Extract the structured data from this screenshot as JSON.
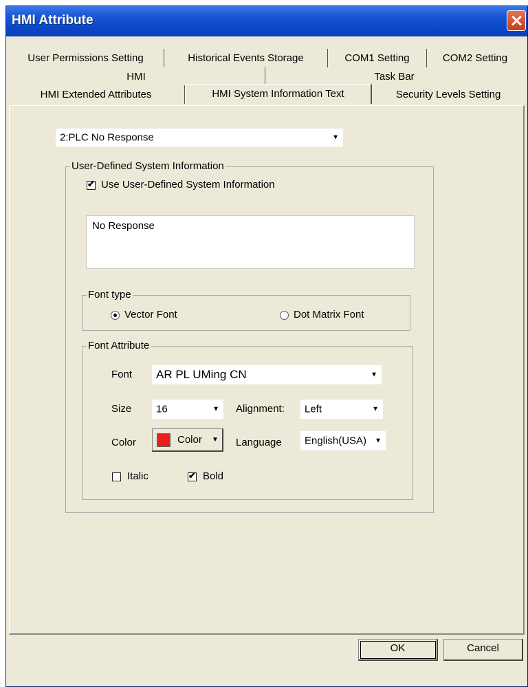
{
  "window": {
    "title": "HMI Attribute"
  },
  "tabs": {
    "row1": [
      "User Permissions Setting",
      "Historical Events Storage",
      "COM1 Setting",
      "COM2 Setting"
    ],
    "row2": [
      "HMI",
      "Task Bar"
    ],
    "row3": [
      "HMI Extended Attributes",
      "HMI System Information Text",
      "Security Levels Setting"
    ],
    "active": "HMI System Information Text"
  },
  "message_select": {
    "value": "2:PLC No Response"
  },
  "user_defined": {
    "legend": "User-Defined System Information",
    "checkbox_label": "Use User-Defined System Information",
    "checked": true,
    "text": "No Response"
  },
  "font_type": {
    "legend": "Font type",
    "options": [
      "Vector Font",
      "Dot Matrix Font"
    ],
    "selected": "Vector Font"
  },
  "font_attribute": {
    "legend": "Font Attribute",
    "font_label": "Font",
    "font_value": "AR PL UMing CN",
    "size_label": "Size",
    "size_value": "16",
    "alignment_label": "Alignment:",
    "alignment_value": "Left",
    "color_label": "Color",
    "color_button_label": "Color",
    "color_value": "#e8201b",
    "language_label": "Language",
    "language_value": "English(USA)",
    "italic_label": "Italic",
    "italic_checked": false,
    "bold_label": "Bold",
    "bold_checked": true
  },
  "buttons": {
    "ok": "OK",
    "cancel": "Cancel"
  }
}
